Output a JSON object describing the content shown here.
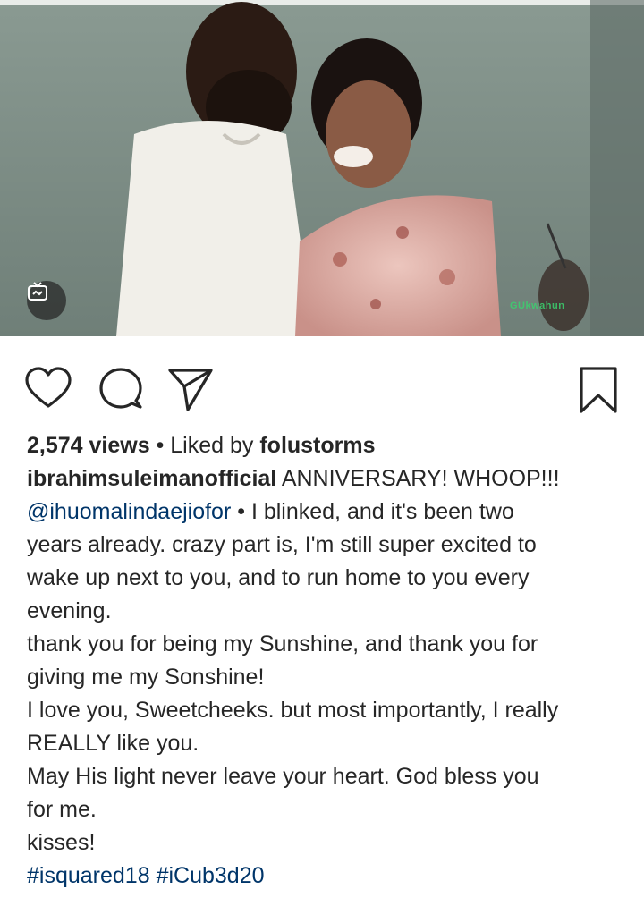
{
  "post": {
    "views": "2,574 views",
    "separator": " • ",
    "liked_by_prefix": "Liked by ",
    "liked_by_user": "folustorms",
    "username": "ibrahimsuleimanofficial",
    "caption_first": " ANNIVERSARY! WHOOP!!!",
    "mention": "@ihuomalindaejiofor",
    "lines": {
      "l2_rest": " • I blinked, and it's been two",
      "l3": "years already. crazy part is, I'm still super excited to",
      "l4": "wake up next to you, and to run home to you every",
      "l5": "evening.",
      "l6": "thank you for being my Sunshine, and thank you for",
      "l7": "giving me my Sonshine!",
      "l8": "I love you, Sweetcheeks. but most importantly, I really",
      "l9": "REALLY like you.",
      "l10": "May His light never leave your heart. God bless you",
      "l11": "for me.",
      "l12": "kisses!"
    },
    "hashtags": [
      "#isquared18",
      "#iCub3d20"
    ]
  },
  "media": {
    "watermark": "GUkwahun"
  },
  "icons": {
    "like": "heart-icon",
    "comment": "comment-icon",
    "share": "paper-plane-icon",
    "save": "bookmark-icon",
    "igtv": "igtv-icon"
  },
  "colors": {
    "link": "#003569",
    "text": "#262626"
  }
}
